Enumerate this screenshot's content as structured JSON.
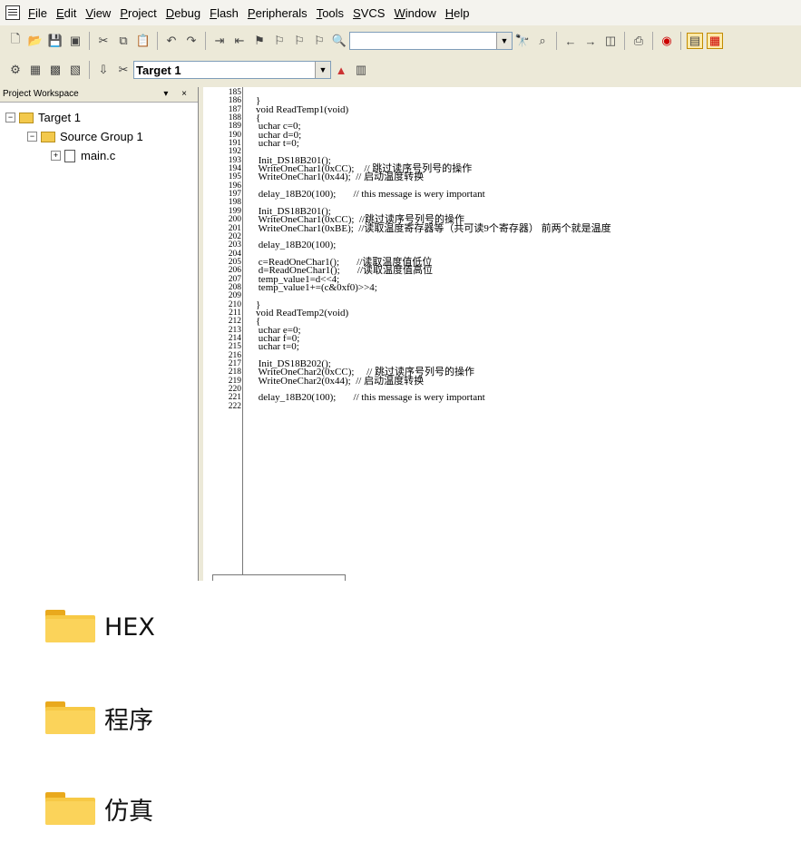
{
  "menu": [
    "File",
    "Edit",
    "View",
    "Project",
    "Debug",
    "Flash",
    "Peripherals",
    "Tools",
    "SVCS",
    "Window",
    "Help"
  ],
  "toolbar2": {
    "target": "Target 1"
  },
  "workspace": {
    "title": "Project Workspace",
    "ctrl": "▾ ×",
    "tree": [
      {
        "label": "Target 1",
        "expander": "−"
      },
      {
        "label": "Source Group 1",
        "expander": "−"
      },
      {
        "label": "main.c",
        "expander": "+"
      }
    ]
  },
  "editor": {
    "lines": [
      {
        "n": "185",
        "code": ""
      },
      {
        "n": "186",
        "code": "}"
      },
      {
        "n": "187",
        "code": "void ReadTemp1(void)"
      },
      {
        "n": "188",
        "code": "{"
      },
      {
        "n": "189",
        "code": " uchar c=0;"
      },
      {
        "n": "190",
        "code": " uchar d=0;"
      },
      {
        "n": "191",
        "code": " uchar t=0;"
      },
      {
        "n": "192",
        "code": ""
      },
      {
        "n": "193",
        "code": " Init_DS18B201();"
      },
      {
        "n": "194",
        "code": " WriteOneChar1(0xCC);    // 跳过读序号列号的操作"
      },
      {
        "n": "195",
        "code": " WriteOneChar1(0x44);  // 启动温度转换"
      },
      {
        "n": "196",
        "code": ""
      },
      {
        "n": "197",
        "code": " delay_18B20(100);       // this message is wery important"
      },
      {
        "n": "198",
        "code": ""
      },
      {
        "n": "199",
        "code": " Init_DS18B201();"
      },
      {
        "n": "200",
        "code": " WriteOneChar1(0xCC);  //跳过读序号列号的操作"
      },
      {
        "n": "201",
        "code": " WriteOneChar1(0xBE);  //读取温度寄存器等（共可读9个寄存器） 前两个就是温度"
      },
      {
        "n": "202",
        "code": ""
      },
      {
        "n": "203",
        "code": " delay_18B20(100);"
      },
      {
        "n": "204",
        "code": ""
      },
      {
        "n": "205",
        "code": " c=ReadOneChar1();       //读取温度值低位"
      },
      {
        "n": "206",
        "code": " d=ReadOneChar1();       //读取温度值高位"
      },
      {
        "n": "207",
        "code": " temp_value1=d<<4;"
      },
      {
        "n": "208",
        "code": " temp_value1+=(c&0xf0)>>4;"
      },
      {
        "n": "209",
        "code": ""
      },
      {
        "n": "210",
        "code": "}"
      },
      {
        "n": "211",
        "code": "void ReadTemp2(void)"
      },
      {
        "n": "212",
        "code": "{"
      },
      {
        "n": "213",
        "code": " uchar e=0;"
      },
      {
        "n": "214",
        "code": " uchar f=0;"
      },
      {
        "n": "215",
        "code": " uchar t=0;"
      },
      {
        "n": "216",
        "code": ""
      },
      {
        "n": "217",
        "code": " Init_DS18B202();"
      },
      {
        "n": "218",
        "code": " WriteOneChar2(0xCC);     // 跳过读序号列号的操作"
      },
      {
        "n": "219",
        "code": " WriteOneChar2(0x44);  // 启动温度转换"
      },
      {
        "n": "220",
        "code": ""
      },
      {
        "n": "221",
        "code": " delay_18B20(100);       // this message is wery important"
      },
      {
        "n": "222",
        "code": ""
      }
    ]
  },
  "folders": [
    {
      "name": "HEX"
    },
    {
      "name": "程序"
    },
    {
      "name": "仿真"
    }
  ]
}
